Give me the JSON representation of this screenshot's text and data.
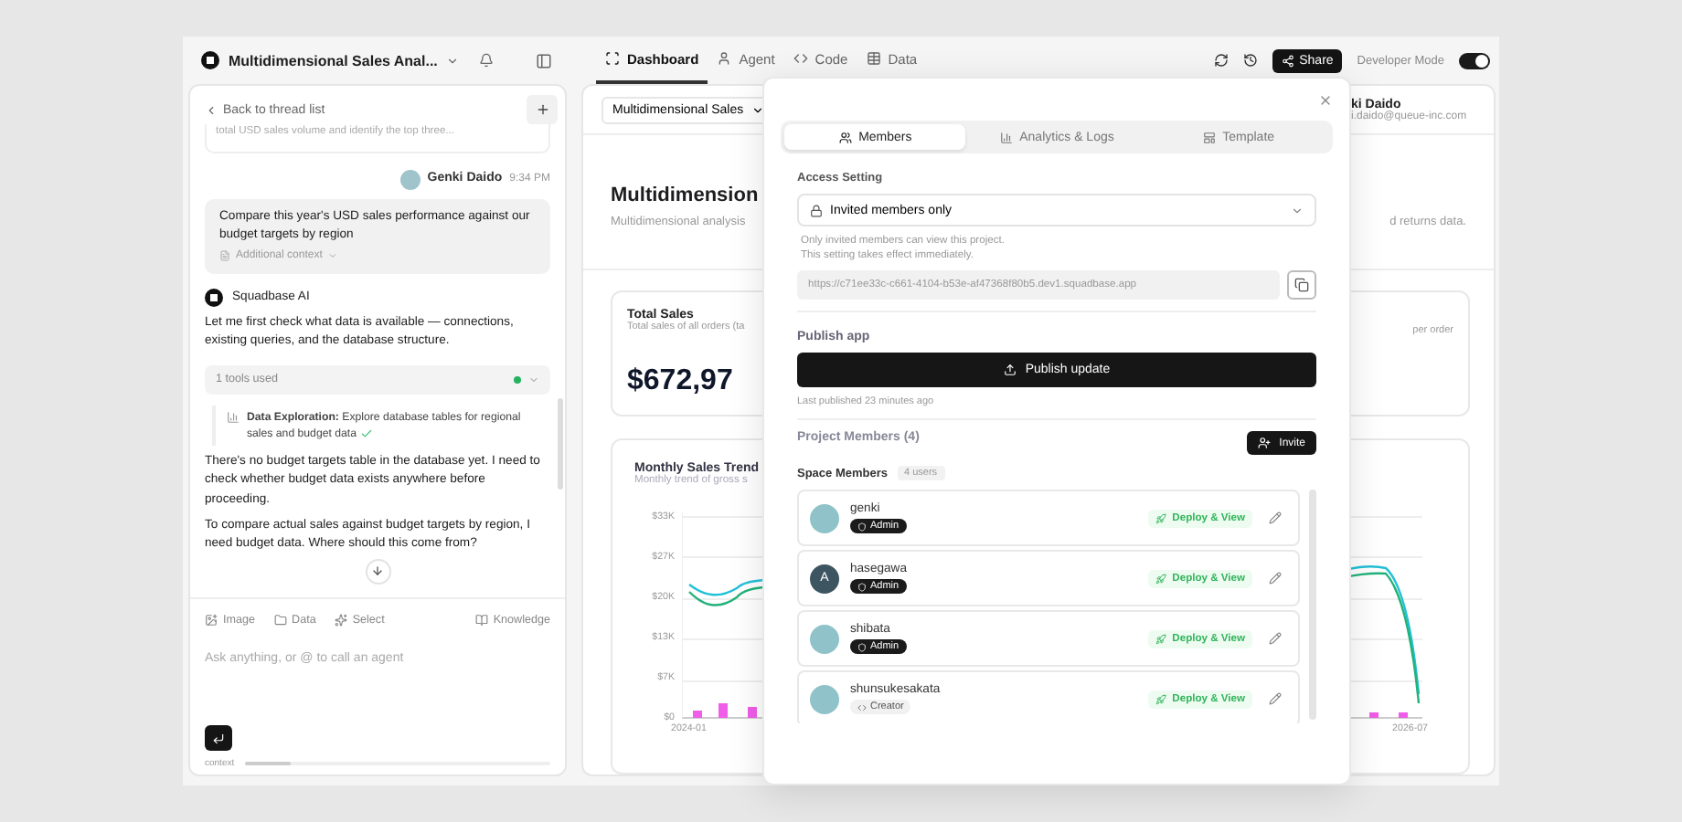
{
  "header": {
    "title": "Multidimensional Sales Anal..."
  },
  "tabs": [
    {
      "label": "Dashboard",
      "selected": true
    },
    {
      "label": "Agent",
      "selected": false
    },
    {
      "label": "Code",
      "selected": false
    },
    {
      "label": "Data",
      "selected": false
    }
  ],
  "actions": {
    "share": "Share",
    "developer_mode": {
      "label": "Developer Mode",
      "on": true
    }
  },
  "thread": {
    "back": "Back to thread list",
    "previous_message": "total USD sales volume and identify the top three...",
    "user_message": {
      "author": "Genki Daido",
      "time": "9:34 PM",
      "text": "Compare this year's USD sales performance against our budget targets by region",
      "context": "Additional context"
    },
    "assistant": {
      "name": "Squadbase AI",
      "intro": "Let me first check what data is available — connections, existing queries, and the database structure.",
      "tools": "1 tools used",
      "step": {
        "text": "**Data Exploration:** Explore database tables for regional sales and budget data",
        "done": true
      },
      "paragraphs": [
        "There's no budget targets table in the database yet. I need to check whether budget data exists anywhere before proceeding.",
        "To compare actual sales against budget targets by region, I need budget data. Where should this come from?"
      ]
    }
  },
  "composer": {
    "tools": [
      "Image",
      "Data",
      "Select"
    ],
    "knowledge": "Knowledge",
    "placeholder": "Ask anything, or @ to call an agent",
    "context": {
      "label": "context",
      "level": 0.15
    }
  },
  "dashboard": {
    "selector": "Multidimensional Sales",
    "user": {
      "name": "ki Daido",
      "email": "i.daido@queue-inc.com"
    },
    "title": "Multidimension",
    "subtitle": "Multidimensional analysis",
    "subtitle_end": "d returns data.",
    "kpis": [
      {
        "title": "Total Sales",
        "subtitle": "Total sales of all orders (ta",
        "value": "$672,97"
      },
      {
        "subtitle": "per order"
      }
    ],
    "chart": {
      "title": "Monthly Sales Trend",
      "subtitle": "Monthly trend of gross s",
      "y_ticks": [
        "$33K",
        "$27K",
        "$20K",
        "$13K",
        "$7K",
        "$0"
      ],
      "x_labels": [
        "2024-01",
        "2026-07"
      ]
    }
  },
  "modal": {
    "tabs": [
      {
        "label": "Members",
        "selected": true
      },
      {
        "label": "Analytics & Logs",
        "selected": false
      },
      {
        "label": "Template",
        "selected": false
      }
    ],
    "access": {
      "label": "Access Setting",
      "value": "Invited members only",
      "hints": [
        "Only invited members can view this project.",
        "This setting takes effect immediately."
      ],
      "url": "https://c71ee33c-c661-4104-b53e-af47368f80b5.dev1.squadbase.app"
    },
    "publish": {
      "label": "Publish app",
      "button": "Publish update",
      "note": "Last published 23 minutes ago"
    },
    "members": {
      "title": "Project Members (4)",
      "invite": "Invite",
      "group": "Space Members",
      "count": "4 users",
      "list": [
        {
          "name": "genki",
          "role": "Admin",
          "kind": "admin",
          "permission": "Deploy & View"
        },
        {
          "name": "hasegawa",
          "initial": "A",
          "role": "Admin",
          "kind": "admin",
          "permission": "Deploy & View"
        },
        {
          "name": "shibata",
          "role": "Admin",
          "kind": "admin",
          "permission": "Deploy & View"
        },
        {
          "name": "shunsukesakata",
          "role": "Creator",
          "kind": "creator",
          "permission": "Deploy & View"
        }
      ]
    }
  }
}
